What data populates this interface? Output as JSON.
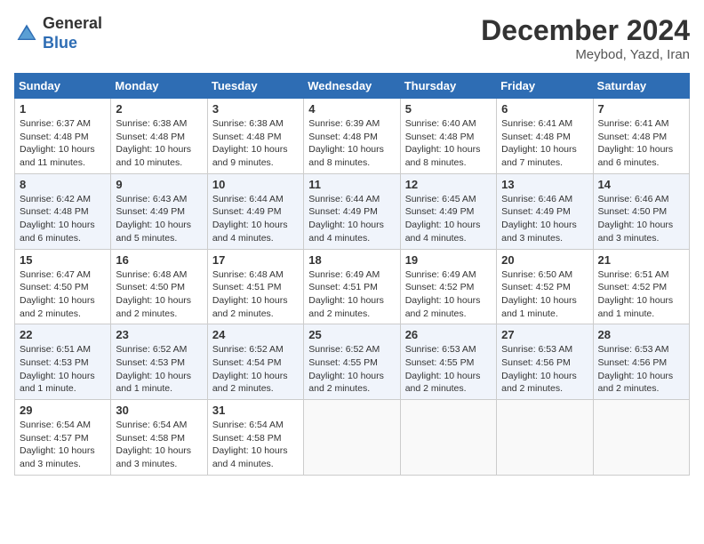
{
  "header": {
    "logo_line1": "General",
    "logo_line2": "Blue",
    "month_title": "December 2024",
    "location": "Meybod, Yazd, Iran"
  },
  "weekdays": [
    "Sunday",
    "Monday",
    "Tuesday",
    "Wednesday",
    "Thursday",
    "Friday",
    "Saturday"
  ],
  "weeks": [
    [
      {
        "day": "1",
        "sunrise": "6:37 AM",
        "sunset": "4:48 PM",
        "daylight": "10 hours and 11 minutes."
      },
      {
        "day": "2",
        "sunrise": "6:38 AM",
        "sunset": "4:48 PM",
        "daylight": "10 hours and 10 minutes."
      },
      {
        "day": "3",
        "sunrise": "6:38 AM",
        "sunset": "4:48 PM",
        "daylight": "10 hours and 9 minutes."
      },
      {
        "day": "4",
        "sunrise": "6:39 AM",
        "sunset": "4:48 PM",
        "daylight": "10 hours and 8 minutes."
      },
      {
        "day": "5",
        "sunrise": "6:40 AM",
        "sunset": "4:48 PM",
        "daylight": "10 hours and 8 minutes."
      },
      {
        "day": "6",
        "sunrise": "6:41 AM",
        "sunset": "4:48 PM",
        "daylight": "10 hours and 7 minutes."
      },
      {
        "day": "7",
        "sunrise": "6:41 AM",
        "sunset": "4:48 PM",
        "daylight": "10 hours and 6 minutes."
      }
    ],
    [
      {
        "day": "8",
        "sunrise": "6:42 AM",
        "sunset": "4:48 PM",
        "daylight": "10 hours and 6 minutes."
      },
      {
        "day": "9",
        "sunrise": "6:43 AM",
        "sunset": "4:49 PM",
        "daylight": "10 hours and 5 minutes."
      },
      {
        "day": "10",
        "sunrise": "6:44 AM",
        "sunset": "4:49 PM",
        "daylight": "10 hours and 4 minutes."
      },
      {
        "day": "11",
        "sunrise": "6:44 AM",
        "sunset": "4:49 PM",
        "daylight": "10 hours and 4 minutes."
      },
      {
        "day": "12",
        "sunrise": "6:45 AM",
        "sunset": "4:49 PM",
        "daylight": "10 hours and 4 minutes."
      },
      {
        "day": "13",
        "sunrise": "6:46 AM",
        "sunset": "4:49 PM",
        "daylight": "10 hours and 3 minutes."
      },
      {
        "day": "14",
        "sunrise": "6:46 AM",
        "sunset": "4:50 PM",
        "daylight": "10 hours and 3 minutes."
      }
    ],
    [
      {
        "day": "15",
        "sunrise": "6:47 AM",
        "sunset": "4:50 PM",
        "daylight": "10 hours and 2 minutes."
      },
      {
        "day": "16",
        "sunrise": "6:48 AM",
        "sunset": "4:50 PM",
        "daylight": "10 hours and 2 minutes."
      },
      {
        "day": "17",
        "sunrise": "6:48 AM",
        "sunset": "4:51 PM",
        "daylight": "10 hours and 2 minutes."
      },
      {
        "day": "18",
        "sunrise": "6:49 AM",
        "sunset": "4:51 PM",
        "daylight": "10 hours and 2 minutes."
      },
      {
        "day": "19",
        "sunrise": "6:49 AM",
        "sunset": "4:52 PM",
        "daylight": "10 hours and 2 minutes."
      },
      {
        "day": "20",
        "sunrise": "6:50 AM",
        "sunset": "4:52 PM",
        "daylight": "10 hours and 1 minute."
      },
      {
        "day": "21",
        "sunrise": "6:51 AM",
        "sunset": "4:52 PM",
        "daylight": "10 hours and 1 minute."
      }
    ],
    [
      {
        "day": "22",
        "sunrise": "6:51 AM",
        "sunset": "4:53 PM",
        "daylight": "10 hours and 1 minute."
      },
      {
        "day": "23",
        "sunrise": "6:52 AM",
        "sunset": "4:53 PM",
        "daylight": "10 hours and 1 minute."
      },
      {
        "day": "24",
        "sunrise": "6:52 AM",
        "sunset": "4:54 PM",
        "daylight": "10 hours and 2 minutes."
      },
      {
        "day": "25",
        "sunrise": "6:52 AM",
        "sunset": "4:55 PM",
        "daylight": "10 hours and 2 minutes."
      },
      {
        "day": "26",
        "sunrise": "6:53 AM",
        "sunset": "4:55 PM",
        "daylight": "10 hours and 2 minutes."
      },
      {
        "day": "27",
        "sunrise": "6:53 AM",
        "sunset": "4:56 PM",
        "daylight": "10 hours and 2 minutes."
      },
      {
        "day": "28",
        "sunrise": "6:53 AM",
        "sunset": "4:56 PM",
        "daylight": "10 hours and 2 minutes."
      }
    ],
    [
      {
        "day": "29",
        "sunrise": "6:54 AM",
        "sunset": "4:57 PM",
        "daylight": "10 hours and 3 minutes."
      },
      {
        "day": "30",
        "sunrise": "6:54 AM",
        "sunset": "4:58 PM",
        "daylight": "10 hours and 3 minutes."
      },
      {
        "day": "31",
        "sunrise": "6:54 AM",
        "sunset": "4:58 PM",
        "daylight": "10 hours and 4 minutes."
      },
      null,
      null,
      null,
      null
    ]
  ]
}
